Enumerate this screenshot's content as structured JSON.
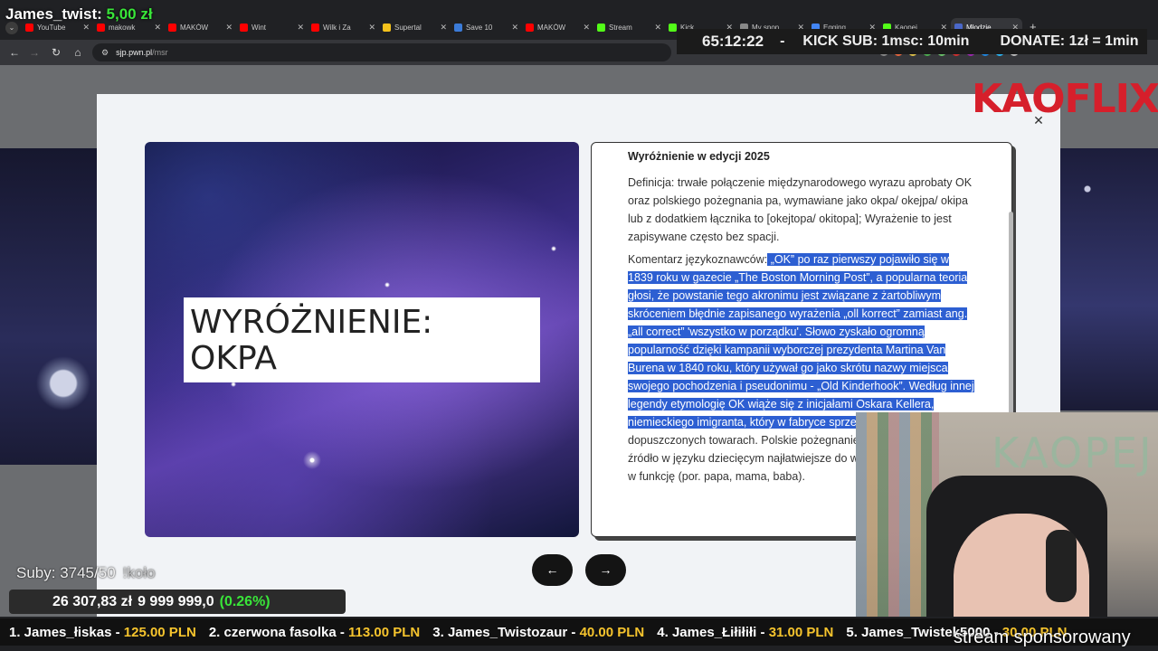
{
  "browser": {
    "tabs": [
      {
        "label": "YouTube",
        "color": "#ff0000"
      },
      {
        "label": "makowk",
        "color": "#ff0000"
      },
      {
        "label": "MAKÓW",
        "color": "#ff0000"
      },
      {
        "label": "Wint",
        "color": "#ff0000"
      },
      {
        "label": "Wilk i Za",
        "color": "#ff0000"
      },
      {
        "label": "Supertal",
        "color": "#f4c21c"
      },
      {
        "label": "Save 10",
        "color": "#3b7bd8"
      },
      {
        "label": "MAKÓW",
        "color": "#ff0000"
      },
      {
        "label": "Stream",
        "color": "#53fc18"
      },
      {
        "label": "Kick",
        "color": "#53fc18"
      },
      {
        "label": "My spon",
        "color": "#888888"
      },
      {
        "label": "Egging",
        "color": "#4285f4"
      },
      {
        "label": "Kaopej",
        "color": "#53fc18"
      },
      {
        "label": "Młodzie",
        "color": "#4b68c9"
      }
    ],
    "url_host": "sjp.pwn.pl",
    "url_path": "/msr"
  },
  "overlay": {
    "donor_name": "James_twist:",
    "donor_amount": "5,00 zł",
    "timer": "65:12:22",
    "dash": "-",
    "kick_sub": "KICK SUB: 1msc: 10min",
    "donate": "DONATE: 1zł = 1min",
    "brand": "KAOFLIX",
    "subs_label": "Suby: 3745/50",
    "subs_ghost": "!koło",
    "goal_current": "26 307,83 zł",
    "goal_target": "9 999 999,0",
    "goal_percent": "(0.26%)",
    "ticker": [
      {
        "name": "1. James_łiskas -",
        "amount": "125.00 PLN"
      },
      {
        "name": "2. czerwona fasolka -",
        "amount": "113.00 PLN"
      },
      {
        "name": "3. James_Twistozaur -",
        "amount": "40.00 PLN"
      },
      {
        "name": "4. James_Łiłiłiłi -",
        "amount": "31.00 PLN"
      },
      {
        "name": "5. James_Twistek5000 -",
        "amount": "30.00 PLN"
      }
    ],
    "sponsored": "stream sponsorowany",
    "webcam_wall_text": "KAOPEJ"
  },
  "modal": {
    "image_title_line1": "WYRÓŻNIENIE:",
    "image_title_line2": "OKPA",
    "heading": "Wyróżnienie w edycji 2025",
    "definition": "Definicja: trwałe połączenie międzynarodowego wyrazu aprobaty OK oraz polskiego pożegnania pa, wymawiane jako okpa/ okejpa/ okipa lub z dodatkiem łącznika to [okejtopa/ okitopa]; Wyrażenie to jest zapisywane często bez spacji.",
    "comment_label": "Komentarz językoznawców:",
    "comment_selected": " „OK” po raz pierwszy pojawiło się w 1839 roku w gazecie „The Boston Morning Post”, a popularna teoria głosi, że powstanie tego akronimu jest związane z żartobliwym skróceniem błędnie zapisanego wyrażenia „oll korrect” zamiast ang. „all correct” 'wszystko w porządku'. Słowo zyskało ogromną popularność dzięki kampanii wyborczej prezydenta Martina Van Burena w 1840 roku, który używał go jako skrótu nazwy miejsca swojego pochodzenia i pseudonimu - „Old Kinderhook”. Według innej legendy etymologię OK wiąże się z inicjałami Oskara Kellera, niemieckiego imigranta, który w fabryce sprzed",
    "comment_rest": "stu lat, który pisał dopuszczonych towarach. Polskie pożegnanie prawdopodobnie źródło w języku dziecięcym najłatwiejsze do wymówienia spółgłoski w funkcję (por. papa, mama, baba).",
    "prev_label": "←",
    "next_label": "→"
  },
  "icons": {
    "close": "close-icon",
    "back": "back-arrow-icon",
    "forward": "forward-arrow-icon",
    "reload": "reload-icon",
    "home": "home-icon"
  }
}
